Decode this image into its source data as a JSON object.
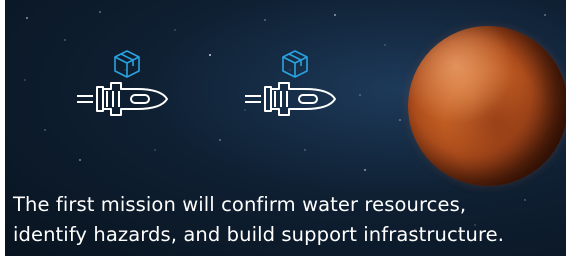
{
  "caption": {
    "line1": "The first mission will confirm water resources,",
    "line2": "identify hazards, and build support infrastructure."
  },
  "icons": {
    "ship": "rocket-ship-icon",
    "cargo": "cargo-box-icon",
    "planet": "mars-planet"
  },
  "colors": {
    "icon_accent": "#2aa3e0",
    "icon_outline": "#ffffff",
    "planet": "#b3501d",
    "text": "#ffffff"
  }
}
